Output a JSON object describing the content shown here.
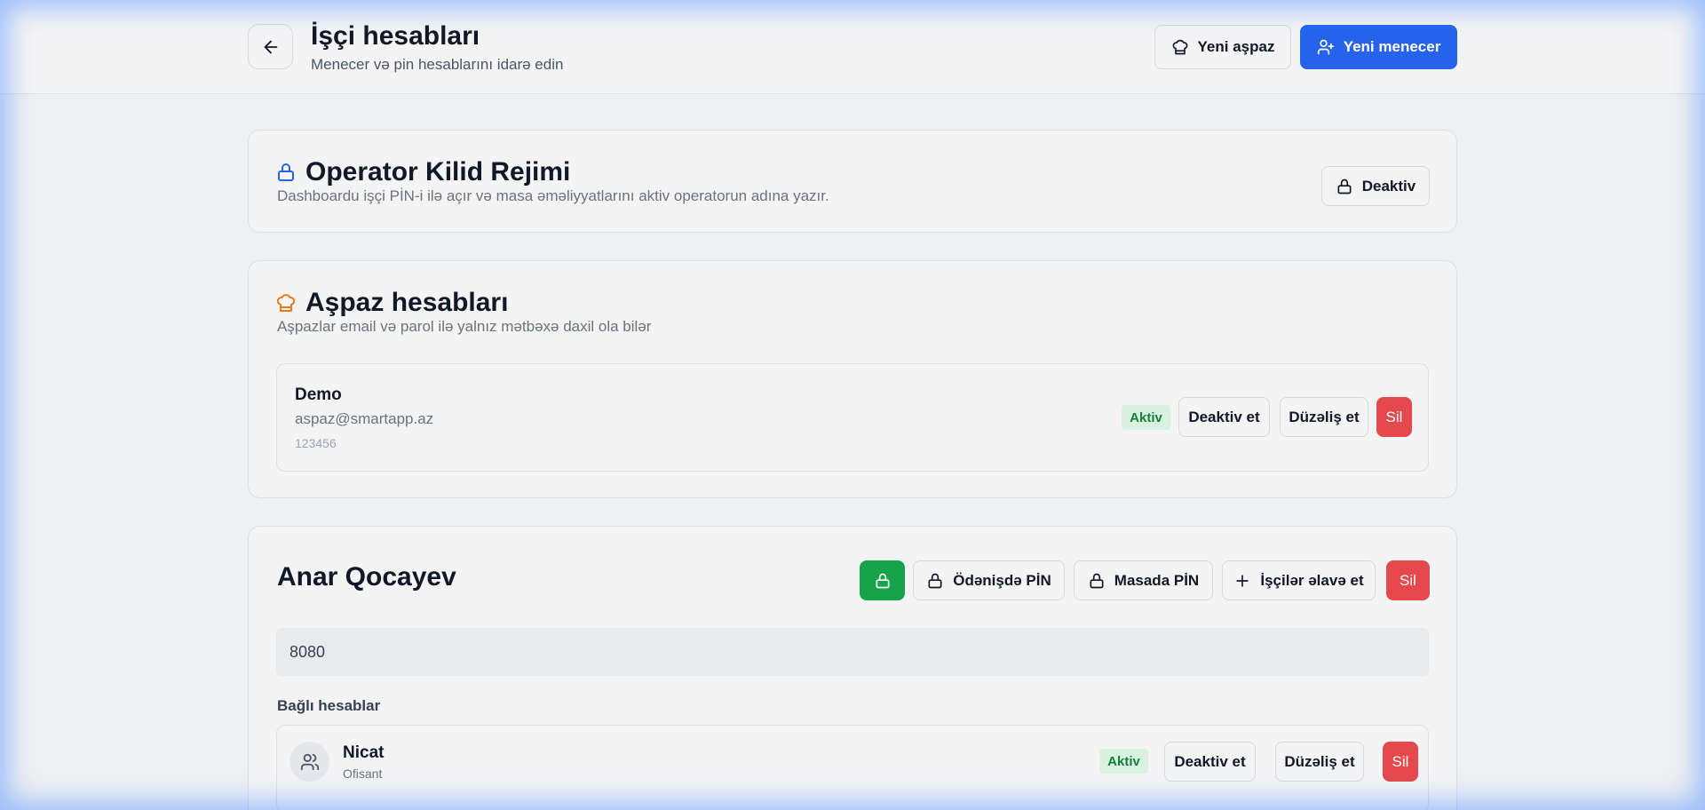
{
  "header": {
    "title": "İşçi hesabları",
    "subtitle": "Menecer və pin hesablarını idarə edin",
    "new_chef_label": "Yeni aşpaz",
    "new_manager_label": "Yeni menecer"
  },
  "operator_lock": {
    "title": "Operator Kilid Rejimi",
    "description": "Dashboardu işçi PİN-i ilə açır və masa əməliyyatlarını aktiv operatorun adına yazır.",
    "toggle_label": "Deaktiv"
  },
  "chefs": {
    "title": "Aşpaz hesabları",
    "description": "Aşpazlar email və parol ilə yalnız mətbəxə daxil ola bilər",
    "items": [
      {
        "name": "Demo",
        "email": "aspaz@smartapp.az",
        "password": "123456",
        "status": "Aktiv",
        "deactivate_label": "Deaktiv et",
        "edit_label": "Düzəliş et",
        "delete_label": "Sil"
      }
    ]
  },
  "manager": {
    "name": "Anar Qocayev",
    "payment_pin_label": "Ödənişdə PİN",
    "table_pin_label": "Masada PİN",
    "add_workers_label": "İşçilər əlavə et",
    "delete_label": "Sil",
    "pin_value": "8080",
    "linked_title": "Bağlı hesablar",
    "linked": [
      {
        "name": "Nicat",
        "role": "Ofisant",
        "status": "Aktiv",
        "deactivate_label": "Deaktiv et",
        "edit_label": "Düzəliş et",
        "delete_label": "Sil"
      }
    ]
  },
  "colors": {
    "primary": "#2563eb",
    "danger": "#e5484d",
    "success": "#16a34a",
    "status_bg": "#d9f2df",
    "status_text": "#15803d",
    "chef_icon": "#ea7a1c",
    "lock_icon": "#2563eb"
  }
}
